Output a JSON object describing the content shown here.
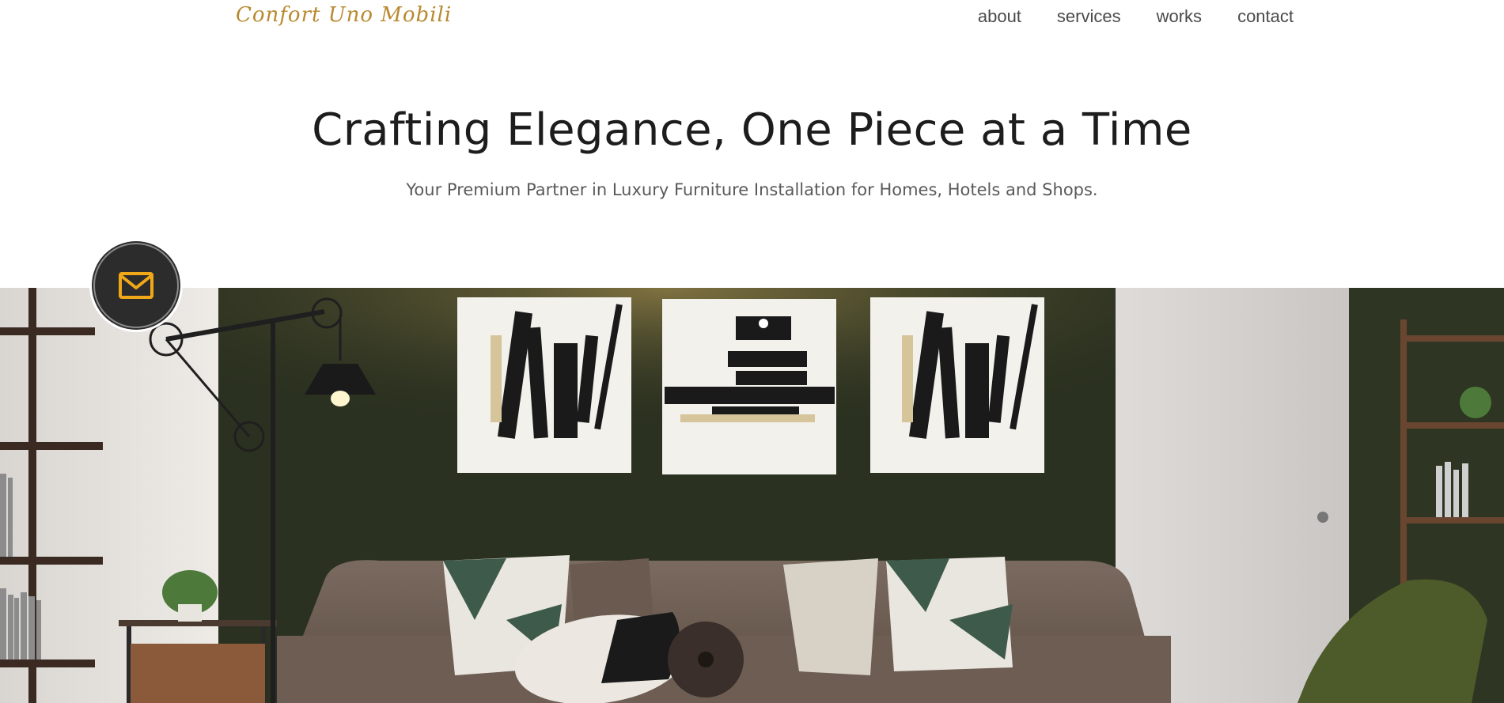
{
  "header": {
    "logo_text": "Confort Uno Mobili",
    "nav": [
      {
        "label": "about"
      },
      {
        "label": "services"
      },
      {
        "label": "works"
      },
      {
        "label": "contact"
      }
    ]
  },
  "hero": {
    "title": "Crafting Elegance, One Piece at a Time",
    "subtitle": "Your Premium Partner in Luxury Furniture Installation for Homes, Hotels and Shops."
  },
  "floating_button": {
    "icon": "mail-icon"
  },
  "colors": {
    "accent": "#f0a818",
    "logo": "#b8892f",
    "wall_green": "#2b3120",
    "sofa": "#6e5d52"
  }
}
